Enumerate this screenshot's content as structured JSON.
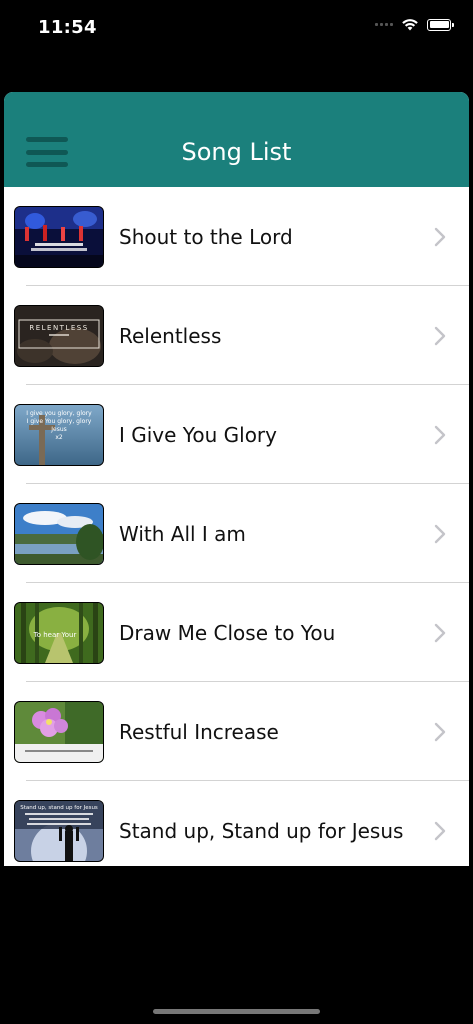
{
  "status_bar": {
    "time": "11:54"
  },
  "nav": {
    "title": "Song List"
  },
  "songs": [
    {
      "title": "Shout to the Lord",
      "thumb_icon": "concert-stage-image"
    },
    {
      "title": "Relentless",
      "thumb_icon": "relentless-title-image",
      "thumb_text": "RELENTLESS"
    },
    {
      "title": "I Give You Glory",
      "thumb_icon": "cross-lyrics-image",
      "thumb_text": "I give you glory, glory\nI give You glory, glory\nJesus\nx2"
    },
    {
      "title": "With All I am",
      "thumb_icon": "lake-landscape-image"
    },
    {
      "title": "Draw Me Close to You",
      "thumb_icon": "forest-path-image",
      "thumb_text": "To hear Your"
    },
    {
      "title": "Restful Increase",
      "thumb_icon": "pink-flower-image"
    },
    {
      "title": "Stand up, Stand up for Jesus",
      "thumb_icon": "worship-silhouette-image",
      "thumb_text": "Stand up, stand up for Jesus"
    }
  ],
  "colors": {
    "nav_bar": "#1b807c",
    "menu_lines": "#0f5855",
    "chevron": "#c4c4c9"
  }
}
